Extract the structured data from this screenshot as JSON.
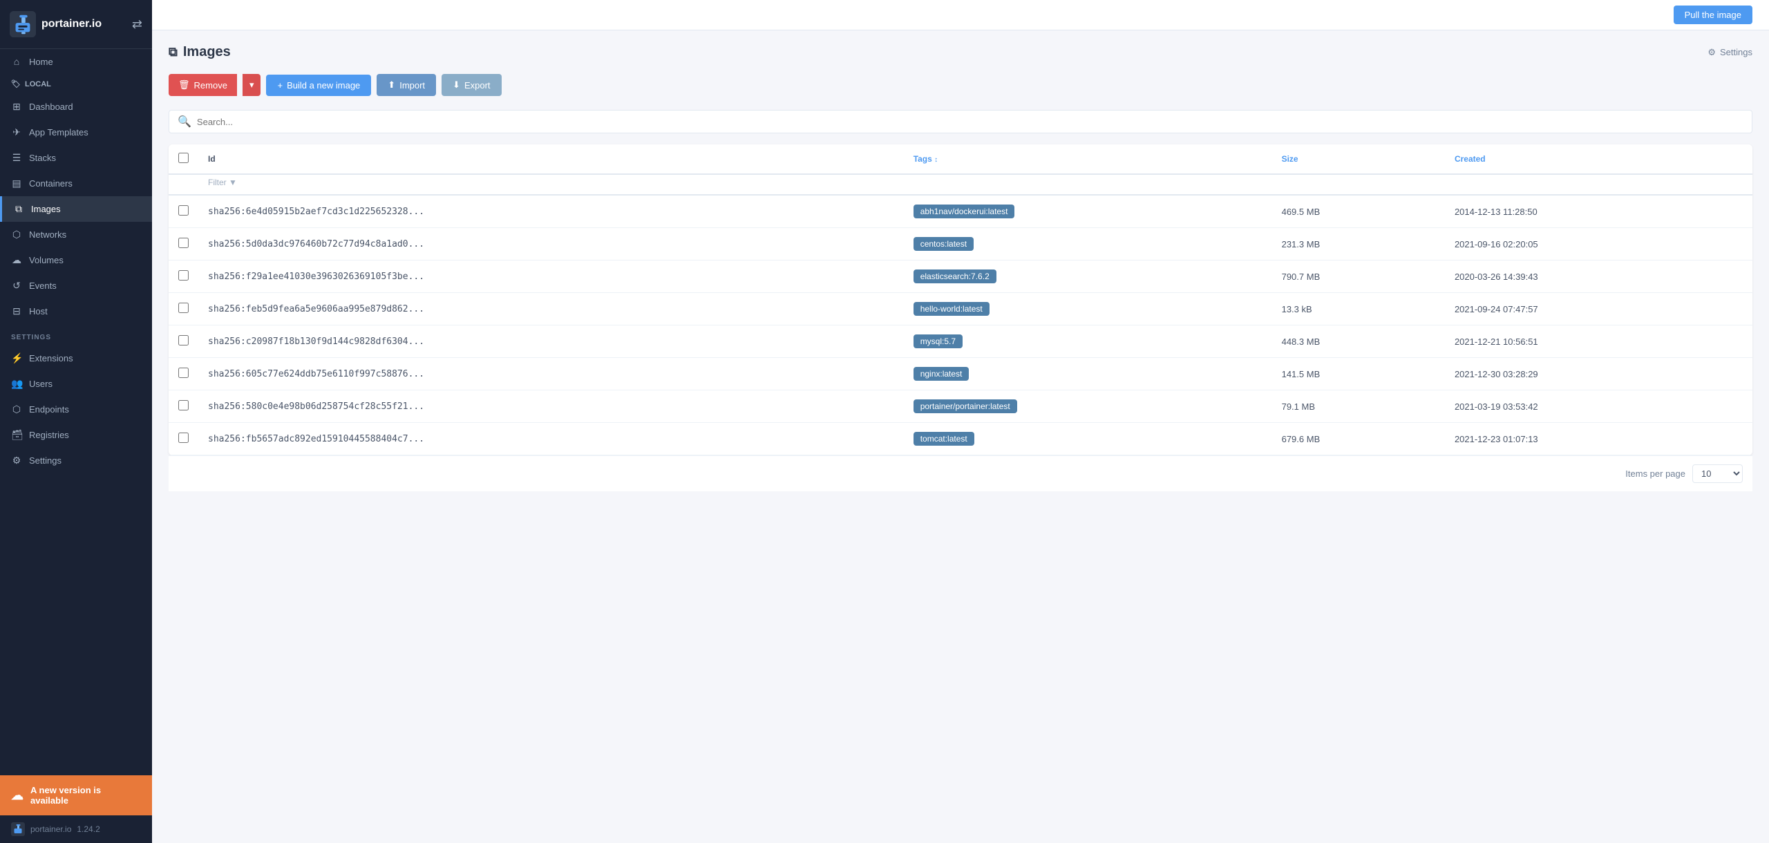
{
  "sidebar": {
    "logo_text": "portainer.io",
    "swap_icon": "⇄",
    "home_label": "Home",
    "local_label": "LOCAL",
    "nav_items": [
      {
        "label": "Dashboard",
        "icon": "⊞",
        "id": "dashboard"
      },
      {
        "label": "App Templates",
        "icon": "✈",
        "id": "app-templates"
      },
      {
        "label": "Stacks",
        "icon": "☰",
        "id": "stacks"
      },
      {
        "label": "Containers",
        "icon": "▤",
        "id": "containers"
      },
      {
        "label": "Images",
        "icon": "⧉",
        "id": "images",
        "active": true
      },
      {
        "label": "Networks",
        "icon": "⬡",
        "id": "networks"
      },
      {
        "label": "Volumes",
        "icon": "☁",
        "id": "volumes"
      },
      {
        "label": "Events",
        "icon": "↺",
        "id": "events"
      },
      {
        "label": "Host",
        "icon": "⊟",
        "id": "host"
      }
    ],
    "settings_label": "SETTINGS",
    "settings_items": [
      {
        "label": "Extensions",
        "icon": "⚡",
        "id": "extensions"
      },
      {
        "label": "Users",
        "icon": "👥",
        "id": "users"
      },
      {
        "label": "Endpoints",
        "icon": "⬡",
        "id": "endpoints"
      },
      {
        "label": "Registries",
        "icon": "🗃",
        "id": "registries"
      },
      {
        "label": "Settings",
        "icon": "⚙",
        "id": "settings"
      }
    ],
    "update_notice": "A new version is available",
    "version_text": "portainer.io",
    "version_number": "1.24.2"
  },
  "topbar": {
    "pull_button": "Pull the image"
  },
  "page": {
    "title": "Images",
    "settings_label": "Settings"
  },
  "toolbar": {
    "remove_label": "Remove",
    "build_label": "Build a new image",
    "import_label": "Import",
    "export_label": "Export"
  },
  "search": {
    "placeholder": "Search..."
  },
  "table": {
    "columns": {
      "id": "Id",
      "filter": "Filter",
      "tags": "Tags",
      "size": "Size",
      "created": "Created"
    },
    "rows": [
      {
        "id": "sha256:6e4d05915b2aef7cd3c1d225652328...",
        "tag": "abh1nav/dockerui:latest",
        "size": "469.5 MB",
        "created": "2014-12-13 11:28:50"
      },
      {
        "id": "sha256:5d0da3dc976460b72c77d94c8a1ad0...",
        "tag": "centos:latest",
        "size": "231.3 MB",
        "created": "2021-09-16 02:20:05"
      },
      {
        "id": "sha256:f29a1ee41030e3963026369105f3be...",
        "tag": "elasticsearch:7.6.2",
        "size": "790.7 MB",
        "created": "2020-03-26 14:39:43"
      },
      {
        "id": "sha256:feb5d9fea6a5e9606aa995e879d862...",
        "tag": "hello-world:latest",
        "size": "13.3 kB",
        "created": "2021-09-24 07:47:57"
      },
      {
        "id": "sha256:c20987f18b130f9d144c9828df6304...",
        "tag": "mysql:5.7",
        "size": "448.3 MB",
        "created": "2021-12-21 10:56:51"
      },
      {
        "id": "sha256:605c77e624ddb75e6110f997c58876...",
        "tag": "nginx:latest",
        "size": "141.5 MB",
        "created": "2021-12-30 03:28:29"
      },
      {
        "id": "sha256:580c0e4e98b06d258754cf28c55f21...",
        "tag": "portainer/portainer:latest",
        "size": "79.1 MB",
        "created": "2021-03-19 03:53:42"
      },
      {
        "id": "sha256:fb5657adc892ed15910445588404c7...",
        "tag": "tomcat:latest",
        "size": "679.6 MB",
        "created": "2021-12-23 01:07:13"
      }
    ]
  },
  "footer": {
    "items_per_page_label": "Items per page",
    "per_page_value": "10"
  }
}
